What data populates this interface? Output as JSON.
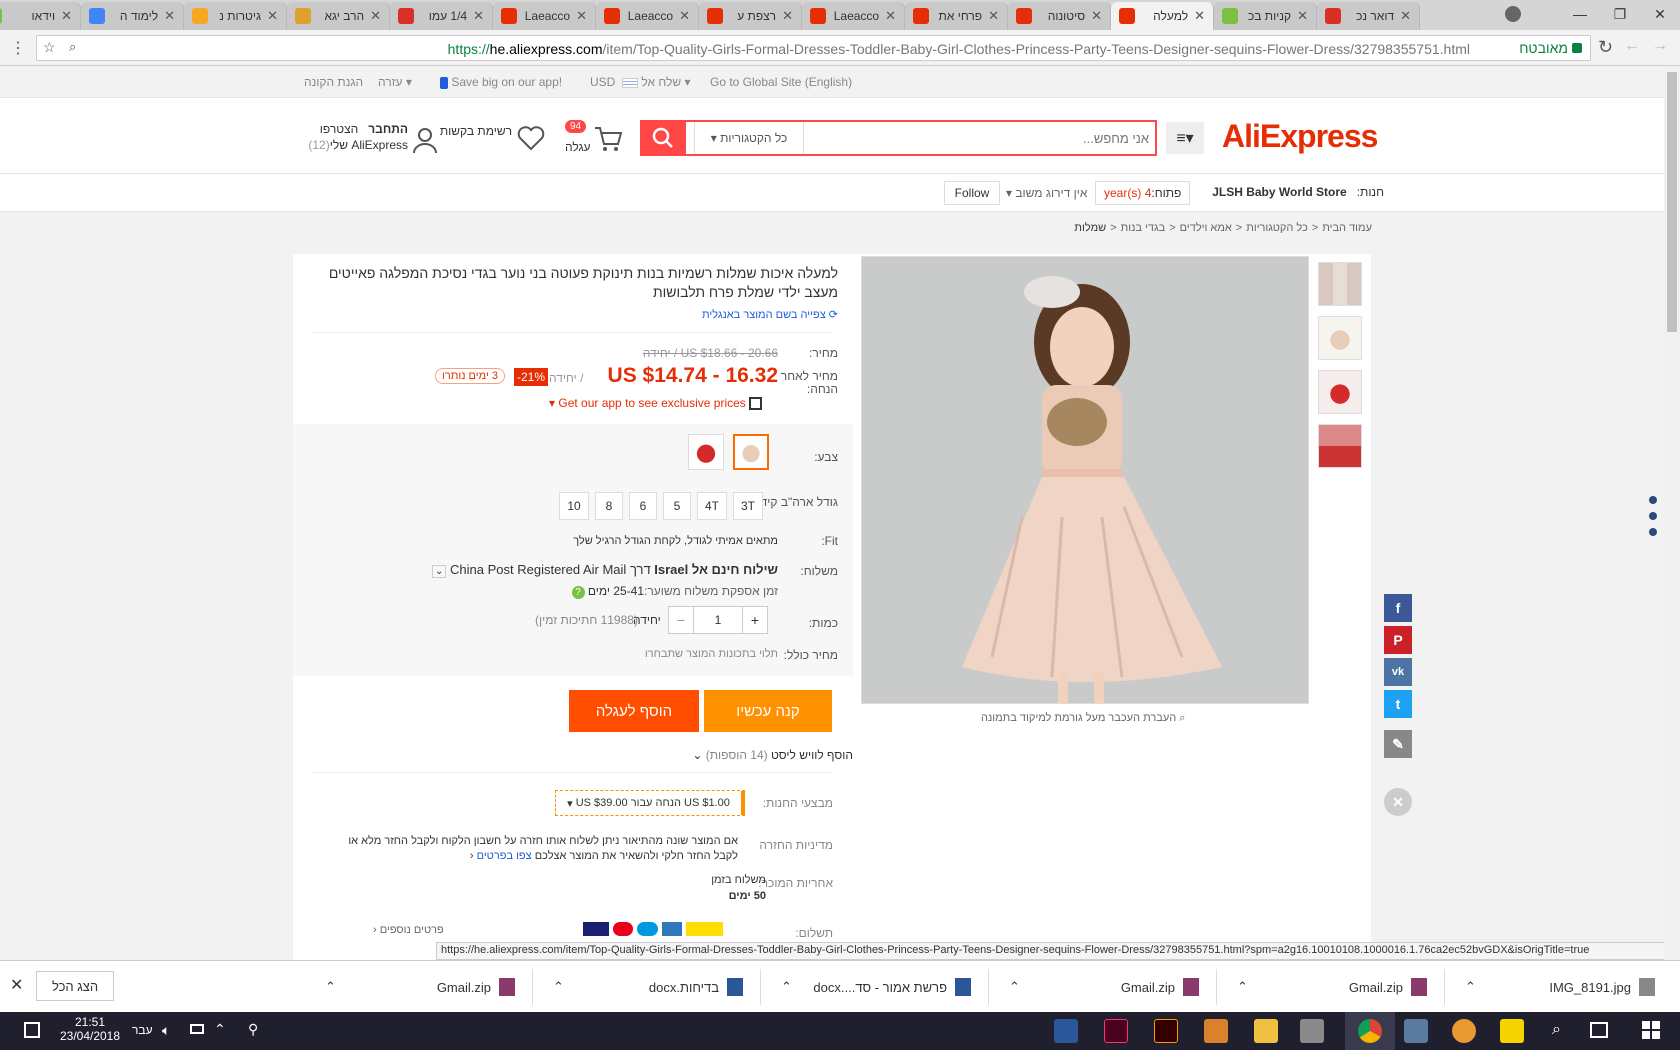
{
  "tabs": [
    {
      "title": "דואר נכ",
      "icon": "gmail-icon",
      "color": "#d93025"
    },
    {
      "title": "קניות בכ",
      "icon": "shop-icon",
      "color": "#7ac142"
    },
    {
      "title": "למעלה",
      "icon": "aliexpress-icon",
      "color": "#e62e04",
      "active": true
    },
    {
      "title": "סיטונוה",
      "icon": "aliexpress-icon",
      "color": "#e62e04"
    },
    {
      "title": "פרחי את",
      "icon": "aliexpress-icon",
      "color": "#e62e04"
    },
    {
      "title": "Laeacco",
      "icon": "aliexpress-icon",
      "color": "#e62e04"
    },
    {
      "title": "רצפת ע",
      "icon": "aliexpress-icon",
      "color": "#e62e04"
    },
    {
      "title": "Laeacco",
      "icon": "aliexpress-icon",
      "color": "#e62e04"
    },
    {
      "title": "Laeacco",
      "icon": "aliexpress-icon",
      "color": "#e62e04"
    },
    {
      "title": "1/4 עמו",
      "icon": "gmail-icon",
      "color": "#d93025"
    },
    {
      "title": "הרב יגא",
      "icon": "burger-icon",
      "color": "#e0a030"
    },
    {
      "title": "גיטרות נ",
      "icon": "guitar-icon",
      "color": "#f5a623"
    },
    {
      "title": "לימוד ה",
      "icon": "google-icon",
      "color": "#4285f4"
    },
    {
      "title": "וידאו",
      "icon": "video-icon",
      "color": "#7ac142"
    }
  ],
  "address": {
    "url_prefix": "https://",
    "url_host": "he.aliexpress.com",
    "url_path": "/item/Top-Quality-Girls-Formal-Dresses-Toddler-Baby-Girl-Clothes-Princess-Party-Teens-Designer-sequins-Flower-Dress/32798355751.html",
    "secure_label": "מאובטח"
  },
  "topnav": {
    "global_site": "Go to Global Site (English)",
    "ship_to": "שלח אל",
    "currency": "USD",
    "app_promo": "Save big on our app!",
    "help": "עזרה",
    "buyer_protection": "הגנת הקונה"
  },
  "header": {
    "logo": "AliExpress",
    "search_placeholder": "אני מחפש...",
    "categories": "כל הקטגוריות",
    "cart_count": "94",
    "cart_label": "עגלה",
    "wishlist_label": "רשימת בקשות",
    "signin": "התחבר",
    "join": "הצטרפו",
    "my_account": "AliExpress שלי",
    "account_count": "(12)"
  },
  "store": {
    "label": "חנות:",
    "name": "JLSH Baby World Store",
    "opened_label": "פתוח:",
    "opened_value": "4",
    "opened_unit": "year(s)",
    "rating": "אין דירוג משוב",
    "follow": "Follow"
  },
  "breadcrumb": [
    "עמוד הבית",
    "כל הקטגוריות",
    "אמא וילדים",
    "בגדי בנות",
    "שמלות"
  ],
  "product": {
    "title": "למעלה איכות שמלות רשמיות בנות תינוקת פעוטה בני נוער בגדי נסיכת המפלגה פאייטים מעצב ילדי שמלת פרח תלבושות",
    "translate_link": "צפייה בשם המוצר באנגלית",
    "price_label": "מחיר:",
    "original_price": "US $18.66 - 20.66 / יחידה",
    "discount_label": "מחיר לאחר הנחה:",
    "discount_price": "US $14.74 - 16.32",
    "per_unit": "/ יחידה",
    "discount_pct": "-21%",
    "days_left": "3 ימים נותרו",
    "app_prices": "Get our app to see exclusive prices",
    "color_label": "צבע:",
    "size_label": "גודל ארה\"ב קיד:",
    "sizes": [
      "3T",
      "4T",
      "5",
      "6",
      "8",
      "10"
    ],
    "fit_label": "Fit:",
    "fit_value": "מתאים אמיתי לגודל, לקחת הגודל הרגיל שלך",
    "shipping_label": "משלוח:",
    "shipping_free": "שילוח חינם אל",
    "shipping_country": "Israel",
    "shipping_via": "דרך China Post Registered Air Mail",
    "delivery_label": "זמן אספקת משלוח משוער:",
    "delivery_value": "25-41 ימים",
    "quantity_label": "כמות:",
    "quantity": "1",
    "qty_unit": "יחידה",
    "stock": "(11988 חתיכות זמין)",
    "total_label": "מחיר כולל:",
    "total_value": "תלוי בתכונות המוצר שתבחרו",
    "buy_now": "קנה עכשיו",
    "add_to_cart": "הוסף לעגלה",
    "wishlist_add": "הוסף לוויש ליסט",
    "wishlist_count": "(14 הוספות)",
    "promo_label": "מבצעי החנות:",
    "promo_value": "US $1.00 הנחה עבור US $39.00",
    "return_label": "מדיניות החזרה",
    "return_text": "אם המוצר שונה מהתיאור ניתן לשלוח אותו חזרה על חשבון הלקוח ולקבל החזר מלא או לקבל החזר חלקי ולהשאיר את המוצר אצלכם",
    "return_more": "צפו בפרטים",
    "warranty_label": "אחריות המוכר:",
    "warranty_text": "משלוח בזמן",
    "warranty_days": "50 ימים",
    "payment_label": "תשלום:",
    "payment_more": "פרטים נוספים",
    "zoom_hint": "העברת העכבר מעל גורמת למיקוד בתמונה"
  },
  "status_url": "https://he.aliexpress.com/item/Top-Quality-Girls-Formal-Dresses-Toddler-Baby-Girl-Clothes-Princess-Party-Teens-Designer-sequins-Flower-Dress/32798355751.html?spm=a2g16.10010108.1000016.1.76ca2ec52bvGDX&isOrigTitle=true",
  "downloads": {
    "show_all": "הצג הכל",
    "files": [
      "IMG_8191.jpg",
      "Gmail.zip",
      "Gmail.zip",
      "פרשת אמור - סד....docx",
      "בדיחות.docx",
      "Gmail.zip"
    ]
  },
  "taskbar": {
    "time": "21:51",
    "date": "23/04/2018",
    "lang": "עבר"
  },
  "colors": {
    "accent": "#ff4747",
    "orange": "#ff6a00",
    "price": "#e62e04"
  }
}
